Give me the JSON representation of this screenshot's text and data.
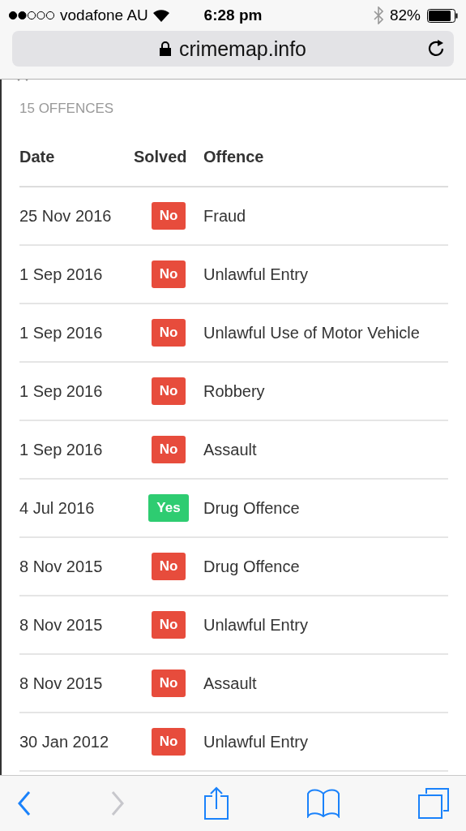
{
  "status_bar": {
    "carrier": "vodafone AU",
    "time": "6:28 pm",
    "battery": "82%"
  },
  "address_bar": {
    "url": "crimemap.info"
  },
  "summary": "15 OFFENCES",
  "table": {
    "columns": [
      "Date",
      "Solved",
      "Offence"
    ],
    "rows": [
      {
        "date": "25 Nov 2016",
        "solved": false,
        "solved_label": "No",
        "offence": "Fraud"
      },
      {
        "date": "1 Sep 2016",
        "solved": false,
        "solved_label": "No",
        "offence": "Unlawful Entry"
      },
      {
        "date": "1 Sep 2016",
        "solved": false,
        "solved_label": "No",
        "offence": "Unlawful Use of Motor Vehicle"
      },
      {
        "date": "1 Sep 2016",
        "solved": false,
        "solved_label": "No",
        "offence": "Robbery"
      },
      {
        "date": "1 Sep 2016",
        "solved": false,
        "solved_label": "No",
        "offence": "Assault"
      },
      {
        "date": "4 Jul 2016",
        "solved": true,
        "solved_label": "Yes",
        "offence": "Drug Offence"
      },
      {
        "date": "8 Nov 2015",
        "solved": false,
        "solved_label": "No",
        "offence": "Drug Offence"
      },
      {
        "date": "8 Nov 2015",
        "solved": false,
        "solved_label": "No",
        "offence": "Unlawful Entry"
      },
      {
        "date": "8 Nov 2015",
        "solved": false,
        "solved_label": "No",
        "offence": "Assault"
      },
      {
        "date": "30 Jan 2012",
        "solved": false,
        "solved_label": "No",
        "offence": "Unlawful Entry"
      }
    ]
  },
  "toolbar": [
    {
      "kind": "back",
      "disabled": false
    },
    {
      "kind": "forward",
      "disabled": true
    },
    {
      "kind": "share",
      "disabled": false
    },
    {
      "kind": "bookmarks",
      "disabled": false
    },
    {
      "kind": "tabs",
      "disabled": false
    }
  ]
}
